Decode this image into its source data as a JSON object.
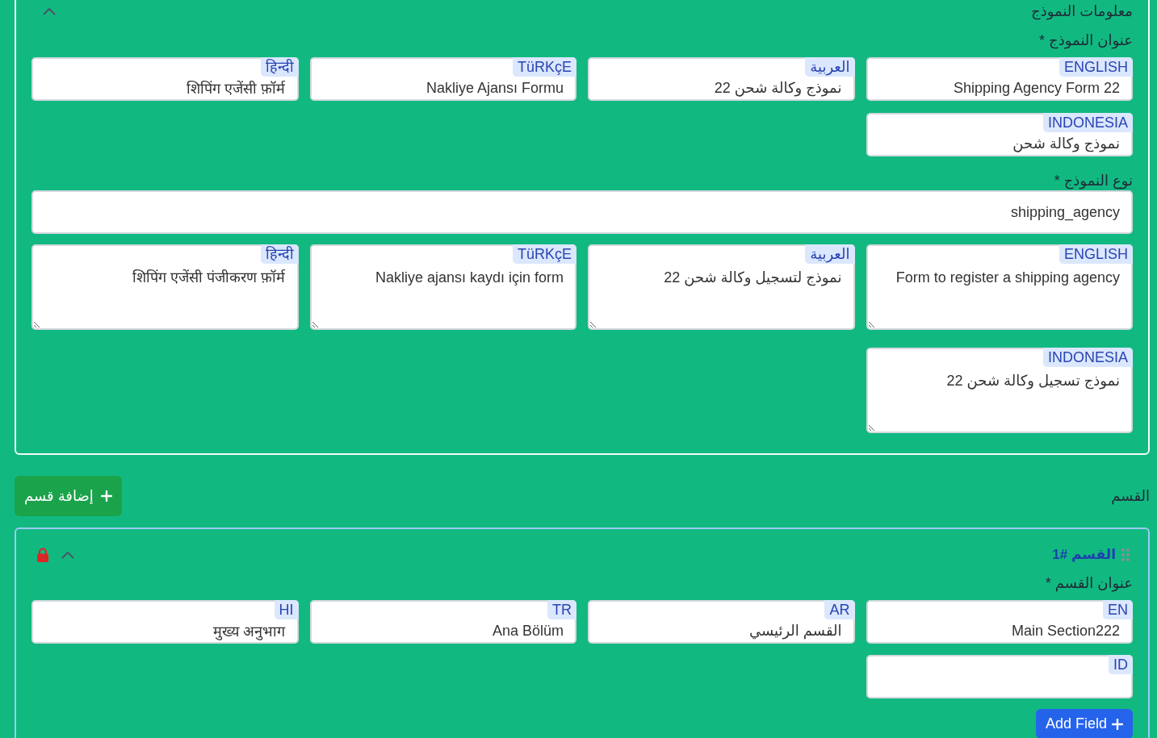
{
  "model_info": {
    "title": "معلومات النموذج",
    "expanded": true,
    "name_field": {
      "label": "عنوان النموذج *",
      "translations": [
        {
          "language": "ENGLISH",
          "value": "Shipping Agency Form 22"
        },
        {
          "language": "العربية",
          "value": "نموذج وكالة شحن 22"
        },
        {
          "language": "TüRKçE",
          "value": "Nakliye Ajansı Formu"
        },
        {
          "language": "हिन्दी",
          "value": "शिपिंग एजेंसी फ़ॉर्म"
        },
        {
          "language": "INDONESIA",
          "value": "نموذج وكالة شحن"
        }
      ]
    },
    "type_field": {
      "label": "نوع النموذج *",
      "value": "shipping_agency"
    },
    "description_field": {
      "translations": [
        {
          "language": "ENGLISH",
          "value": "Form to register a shipping agency"
        },
        {
          "language": "العربية",
          "value": "نموذج لتسجيل وكالة شحن 22"
        },
        {
          "language": "TüRKçE",
          "value": "Nakliye ajansı kaydı için form"
        },
        {
          "language": "हिन्दी",
          "value": "शिपिंग एजेंसी पंजीकरण फ़ॉर्म"
        },
        {
          "language": "INDONESIA",
          "value": "نموذج تسجيل وكالة شحن 22"
        }
      ]
    }
  },
  "sections": {
    "label": "القسم",
    "add_button": "إضافة قسم",
    "items": [
      {
        "title": "القسم #1",
        "locked": true,
        "expanded": true,
        "title_field": {
          "label": "عنوان القسم *",
          "translations": [
            {
              "language": "EN",
              "value": "Main Section222"
            },
            {
              "language": "AR",
              "value": "القسم الرئيسي"
            },
            {
              "language": "TR",
              "value": "Ana Bölüm"
            },
            {
              "language": "HI",
              "value": "मुख्य अनुभाग"
            },
            {
              "language": "ID"
            }
          ]
        },
        "add_field_button": "Add Field"
      }
    ]
  }
}
